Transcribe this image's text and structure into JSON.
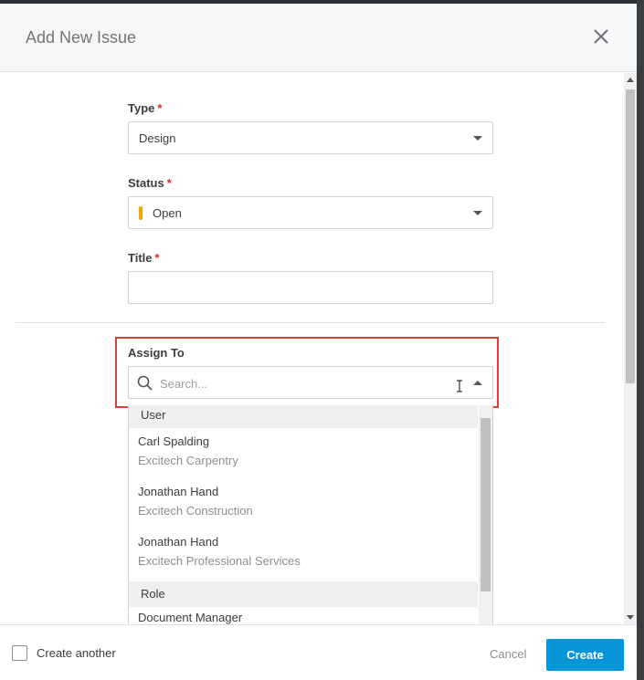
{
  "dialog": {
    "title": "Add New Issue",
    "close_icon": "close-icon"
  },
  "form": {
    "type": {
      "label": "Type",
      "required": "*",
      "value": "Design"
    },
    "status": {
      "label": "Status",
      "required": "*",
      "value": "Open",
      "color": "#f0a600"
    },
    "title": {
      "label": "Title",
      "required": "*",
      "value": ""
    },
    "assign_to": {
      "label": "Assign To",
      "placeholder": "Search...",
      "search_icon": "search-icon"
    }
  },
  "assign_dropdown": {
    "groups": [
      {
        "label": "User"
      },
      {
        "label": "Role"
      }
    ],
    "users": [
      {
        "name": "Carl Spalding",
        "company": "Excitech Carpentry"
      },
      {
        "name": "Jonathan Hand",
        "company": "Excitech Construction"
      },
      {
        "name": "Jonathan Hand",
        "company": "Excitech Professional Services"
      }
    ],
    "roles": [
      {
        "name": "Document Manager"
      }
    ]
  },
  "footer": {
    "create_another_label": "Create another",
    "cancel_label": "Cancel",
    "create_label": "Create"
  },
  "colors": {
    "accent": "#0696d7",
    "required": "#e0282e",
    "highlight": "#e0403c"
  }
}
